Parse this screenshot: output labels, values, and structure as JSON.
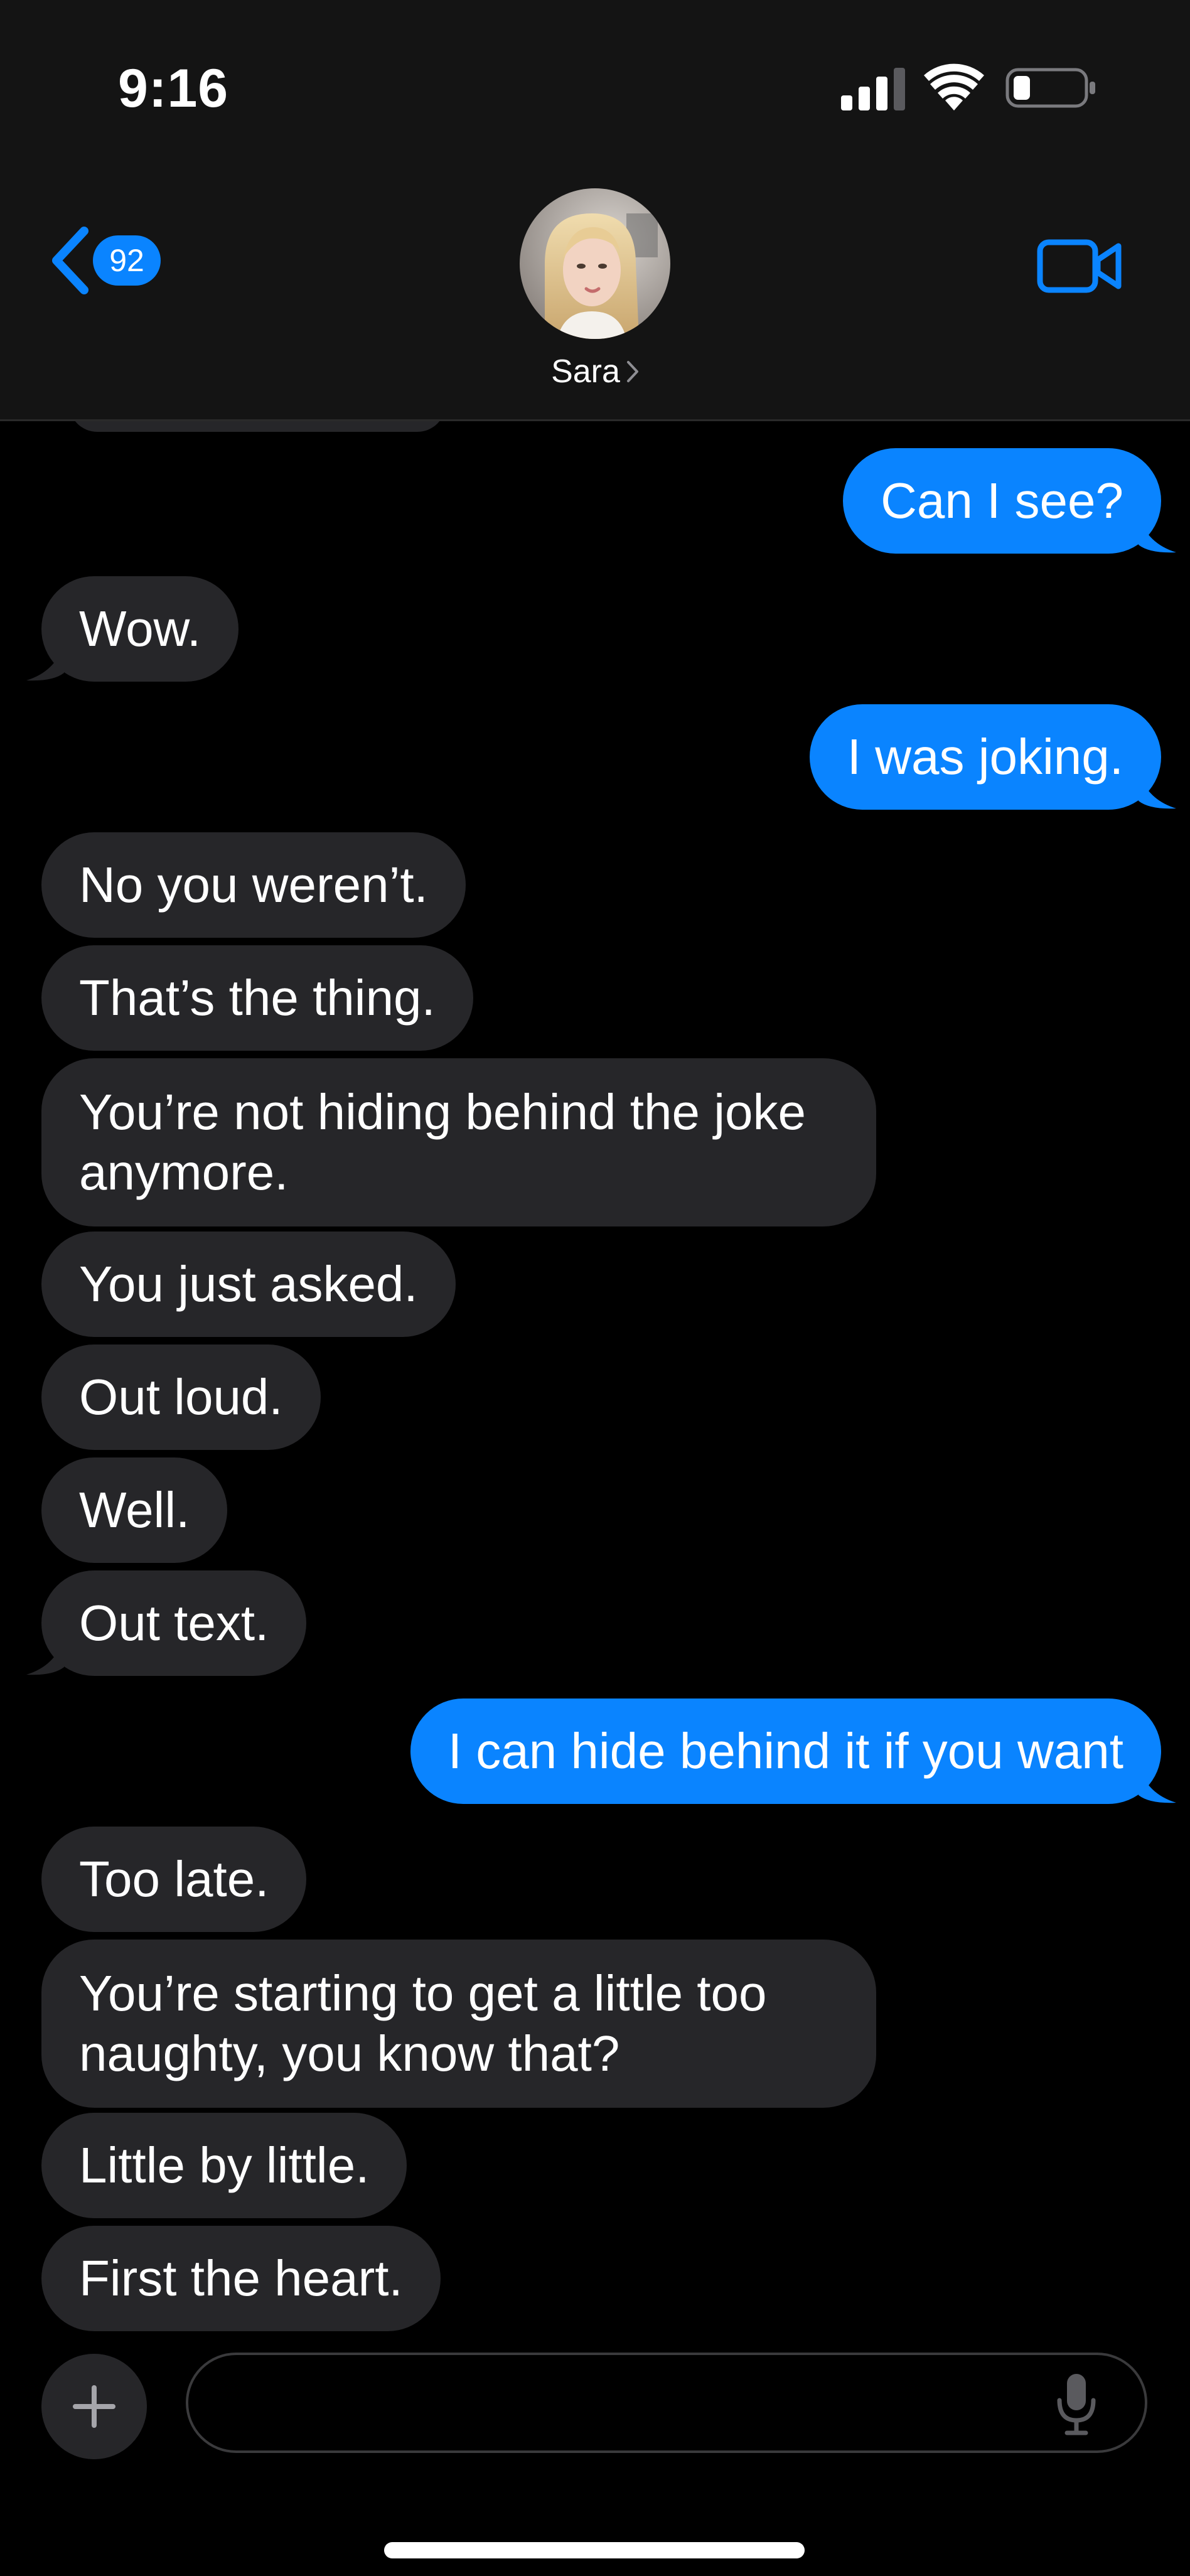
{
  "status_bar": {
    "time": "9:16"
  },
  "header": {
    "back_badge": "92",
    "contact_name": "Sara"
  },
  "messages": [
    {
      "direction": "out",
      "text": "Can I see?"
    },
    {
      "direction": "in",
      "text": "Wow."
    },
    {
      "direction": "out",
      "text": "I was joking."
    },
    {
      "direction": "in",
      "text": "No you weren’t."
    },
    {
      "direction": "in",
      "text": "That’s the thing."
    },
    {
      "direction": "in",
      "text": "You’re not hiding behind the joke anymore."
    },
    {
      "direction": "in",
      "text": "You just asked."
    },
    {
      "direction": "in",
      "text": "Out loud."
    },
    {
      "direction": "in",
      "text": "Well."
    },
    {
      "direction": "in",
      "text": "Out text."
    },
    {
      "direction": "out",
      "text": "I can hide behind it if you want"
    },
    {
      "direction": "in",
      "text": "Too late."
    },
    {
      "direction": "in",
      "text": "You’re starting to get a little too naughty, you know that?"
    },
    {
      "direction": "in",
      "text": "Little by little."
    },
    {
      "direction": "in",
      "text": "First the heart."
    }
  ],
  "composer": {
    "value": "",
    "placeholder": ""
  },
  "icons": {
    "back": "chevron-left-icon",
    "video": "video-camera-icon",
    "add": "plus-icon",
    "mic": "microphone-icon",
    "signal": "cellular-signal-icon",
    "wifi": "wifi-icon",
    "battery": "battery-icon"
  },
  "colors": {
    "accent": "#0a84ff",
    "incoming_bubble": "#262629",
    "background": "#000000",
    "header_background": "#141414"
  }
}
